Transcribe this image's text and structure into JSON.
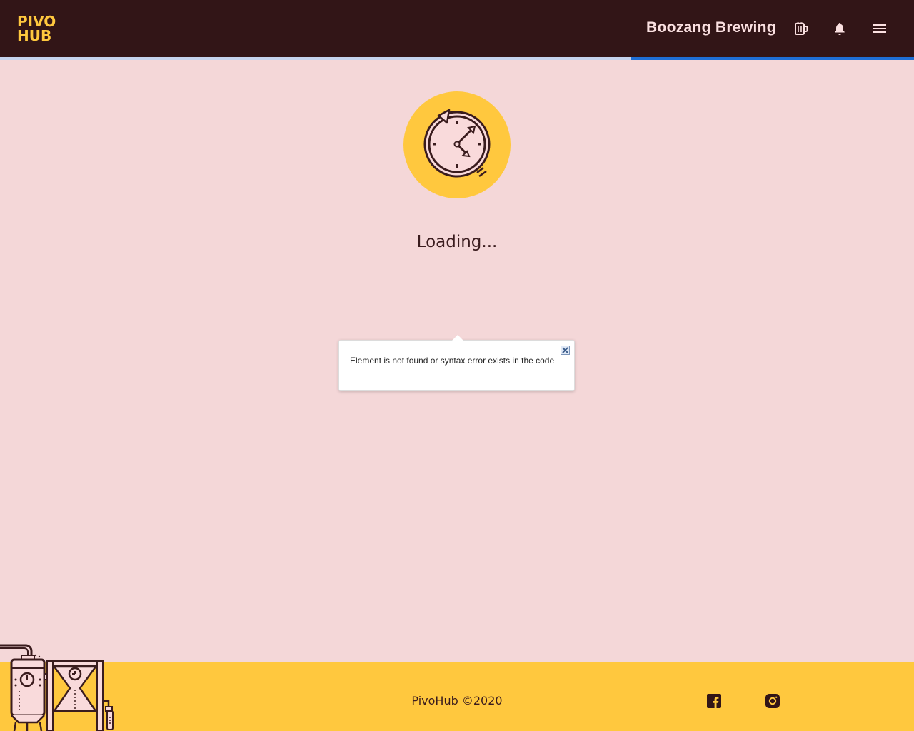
{
  "header": {
    "logo_line1": "PIVO",
    "logo_line2": "HUB",
    "brewery_name": "Boozang Brewing",
    "icons": [
      "beer-mug-icon",
      "bell-icon",
      "menu-icon"
    ]
  },
  "progress": {
    "fraction": 0.31
  },
  "main": {
    "loading_text": "Loading..."
  },
  "tooltip": {
    "message": "Element is not found or syntax error exists in the code"
  },
  "footer": {
    "copyright": "PivoHub ©2020",
    "social_icons": [
      "facebook-icon",
      "instagram-icon"
    ]
  },
  "colors": {
    "header_bg": "#321517",
    "accent_yellow": "#ffc83e",
    "page_bg": "#f4d7d8",
    "progress_blue": "#1f6fd6"
  }
}
